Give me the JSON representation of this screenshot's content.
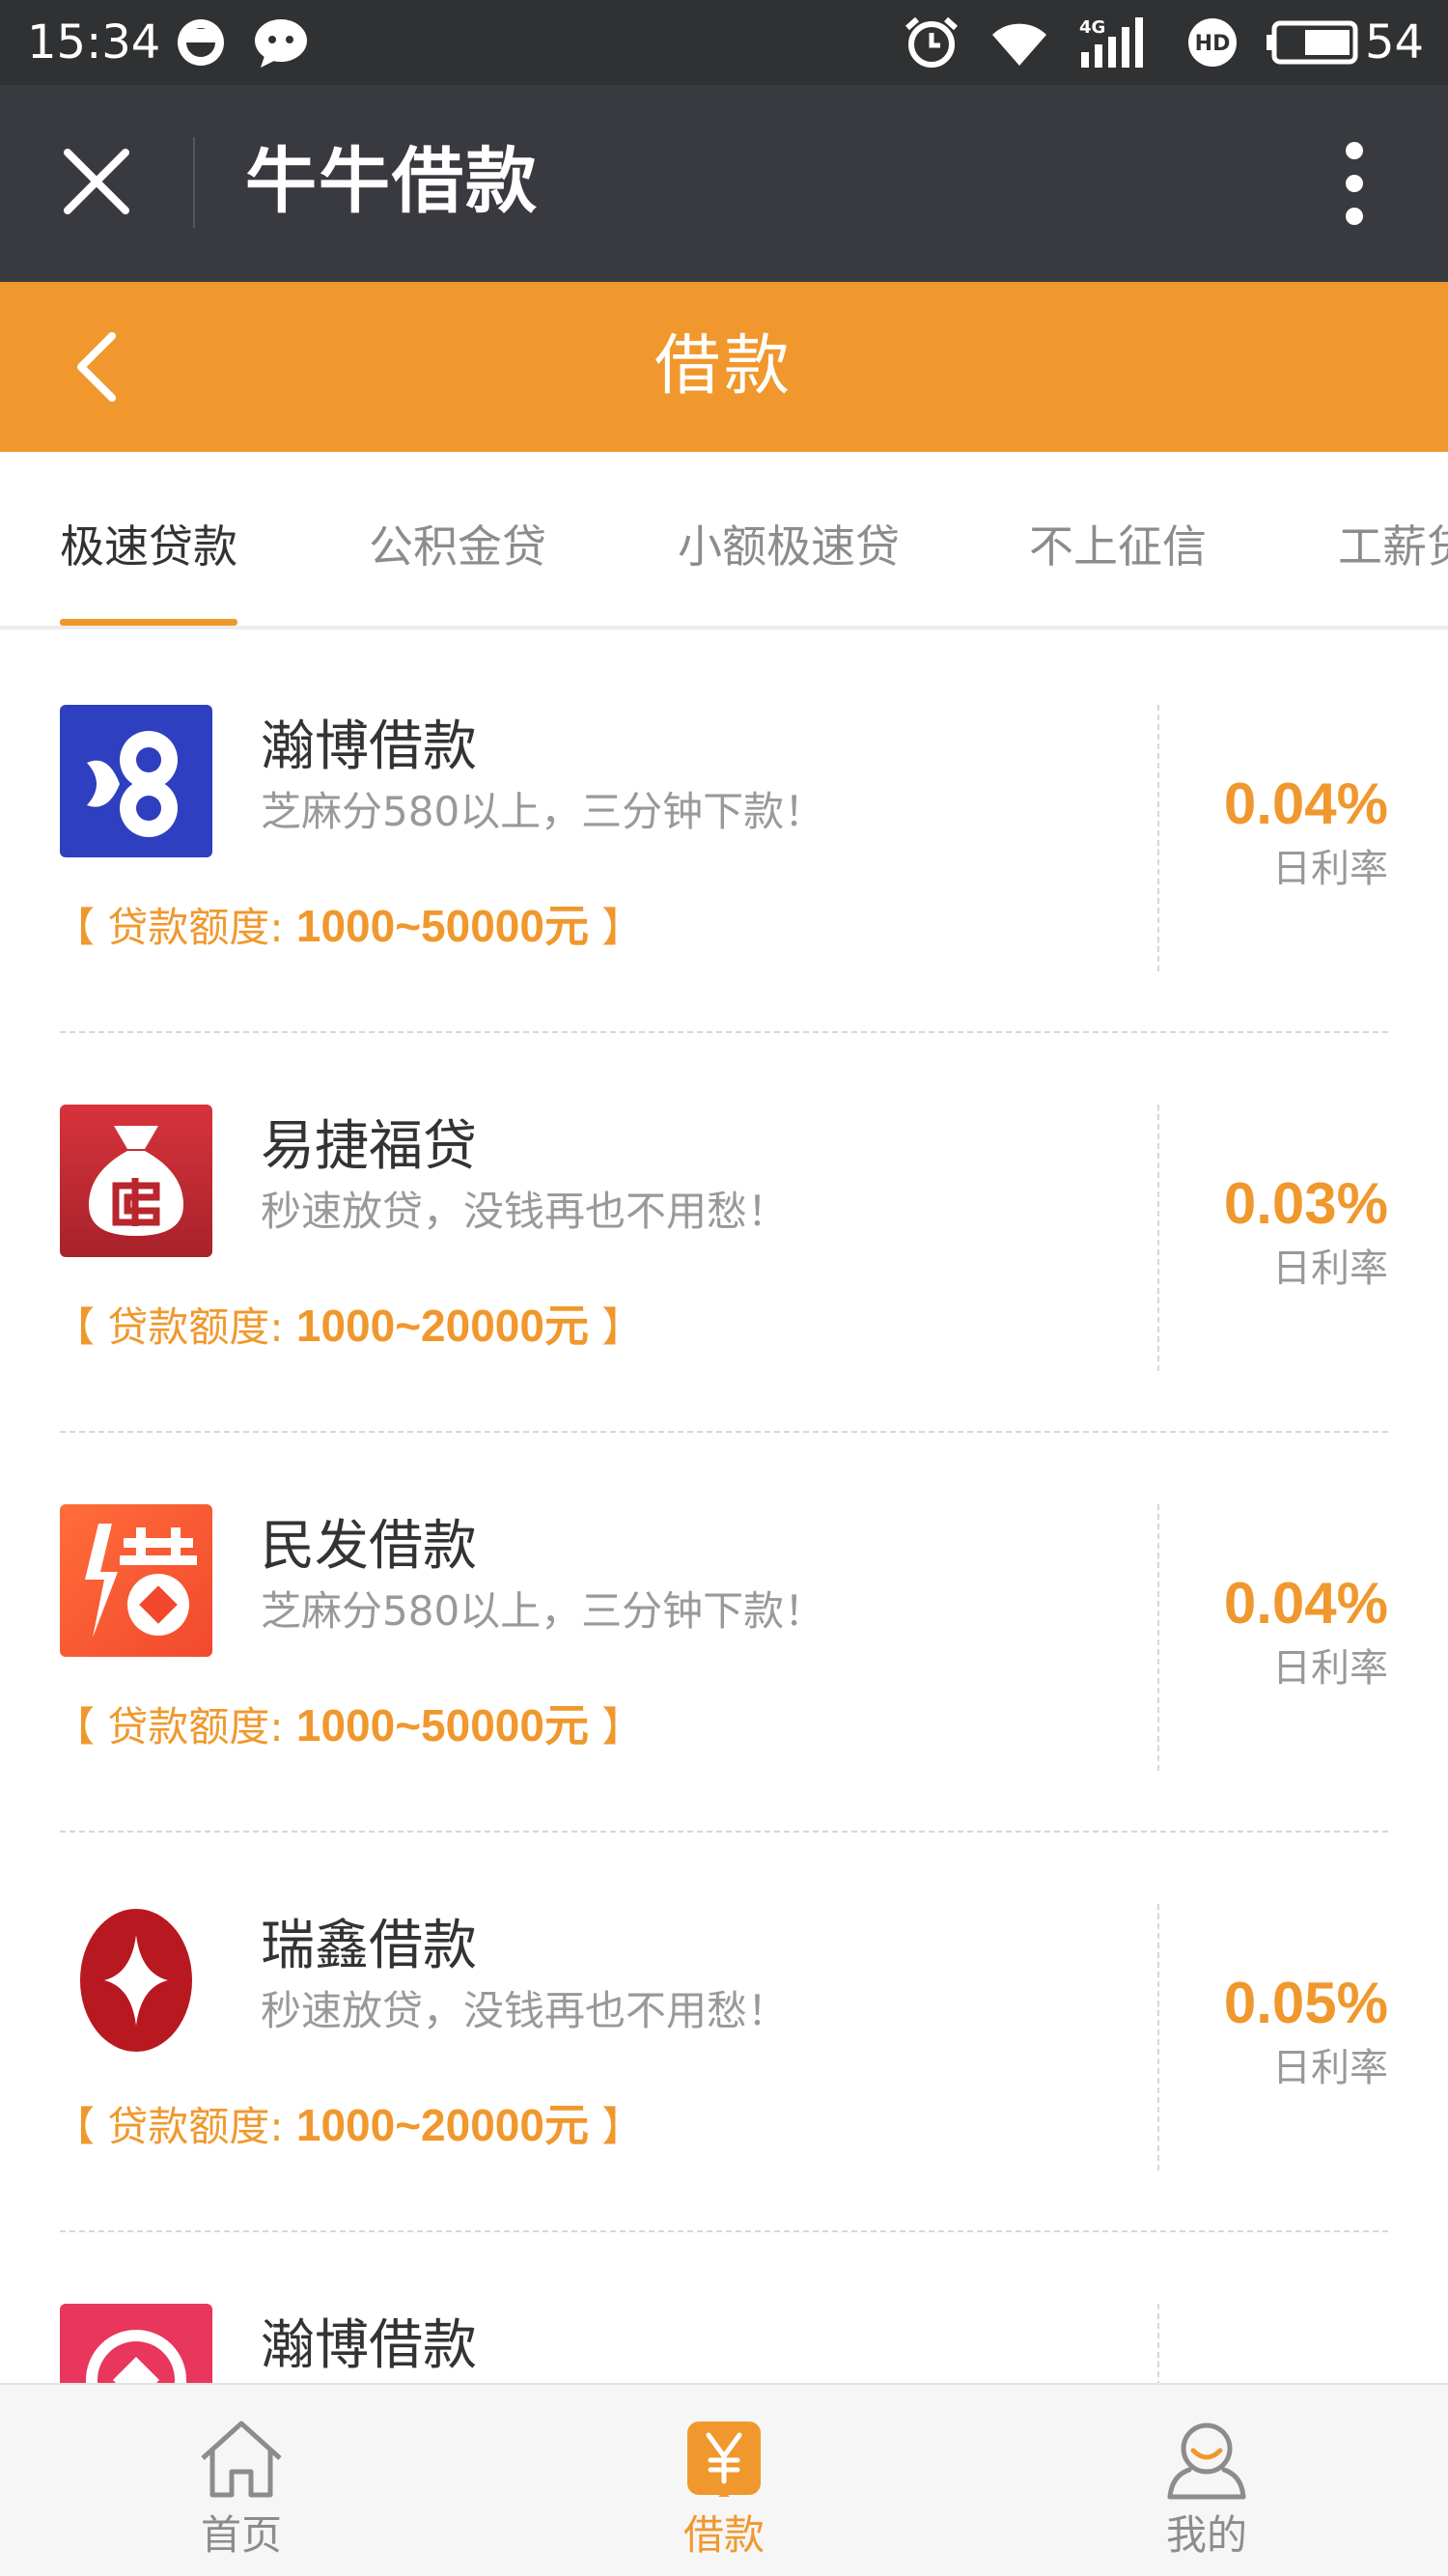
{
  "status_bar": {
    "time": "15:34",
    "network": "4G",
    "battery_percent": "54",
    "icons": [
      "smiley-icon",
      "chat-bubble-icon",
      "alarm-icon",
      "wifi-icon",
      "signal-icon",
      "hd-icon",
      "battery-icon"
    ]
  },
  "titlebar": {
    "title": "牛牛借款",
    "close_icon": "close-icon",
    "more_icon": "more-vertical-icon",
    "background": "#393a3f"
  },
  "header": {
    "title": "借款",
    "back_icon": "chevron-left-icon",
    "background": "#f0982d"
  },
  "tabs": [
    {
      "label": "极速贷款",
      "active": true
    },
    {
      "label": "公积金贷",
      "active": false
    },
    {
      "label": "小额极速贷",
      "active": false
    },
    {
      "label": "不上征信",
      "active": false
    },
    {
      "label": "工薪贷",
      "active": false
    }
  ],
  "loans": [
    {
      "name": "瀚博借款",
      "desc": "芝麻分580以上，三分钟下款！",
      "amount_prefix": "【 贷款额度: ",
      "amount": "1000~50000元",
      "amount_suffix": " 】",
      "rate": "0.04%",
      "rate_label": "日利率",
      "logo": "hanbo-logo-icon"
    },
    {
      "name": "易捷福贷",
      "desc": "秒速放贷，没钱再也不用愁！",
      "amount_prefix": "【 贷款额度: ",
      "amount": "1000~20000元",
      "amount_suffix": " 】",
      "rate": "0.03%",
      "rate_label": "日利率",
      "logo": "money-bag-icon"
    },
    {
      "name": "民发借款",
      "desc": "芝麻分580以上，三分钟下款！",
      "amount_prefix": "【 贷款额度: ",
      "amount": "1000~50000元",
      "amount_suffix": " 】",
      "rate": "0.04%",
      "rate_label": "日利率",
      "logo": "jie-character-logo-icon"
    },
    {
      "name": "瑞鑫借款",
      "desc": "秒速放贷，没钱再也不用愁！",
      "amount_prefix": "【 贷款额度: ",
      "amount": "1000~20000元",
      "amount_suffix": " 】",
      "rate": "0.05%",
      "rate_label": "日利率",
      "logo": "red-seed-logo-icon"
    },
    {
      "name": "瀚博借款",
      "desc": "",
      "amount_prefix": "",
      "amount": "",
      "amount_suffix": "",
      "rate": "",
      "rate_label": "",
      "logo": "pink-coin-logo-icon"
    }
  ],
  "bottom_nav": [
    {
      "label": "首页",
      "icon": "home-icon",
      "active": false
    },
    {
      "label": "借款",
      "icon": "yen-icon",
      "active": true
    },
    {
      "label": "我的",
      "icon": "user-icon",
      "active": false
    }
  ],
  "colors": {
    "accent": "#f0982d",
    "text": "#333333",
    "muted": "#999999"
  }
}
